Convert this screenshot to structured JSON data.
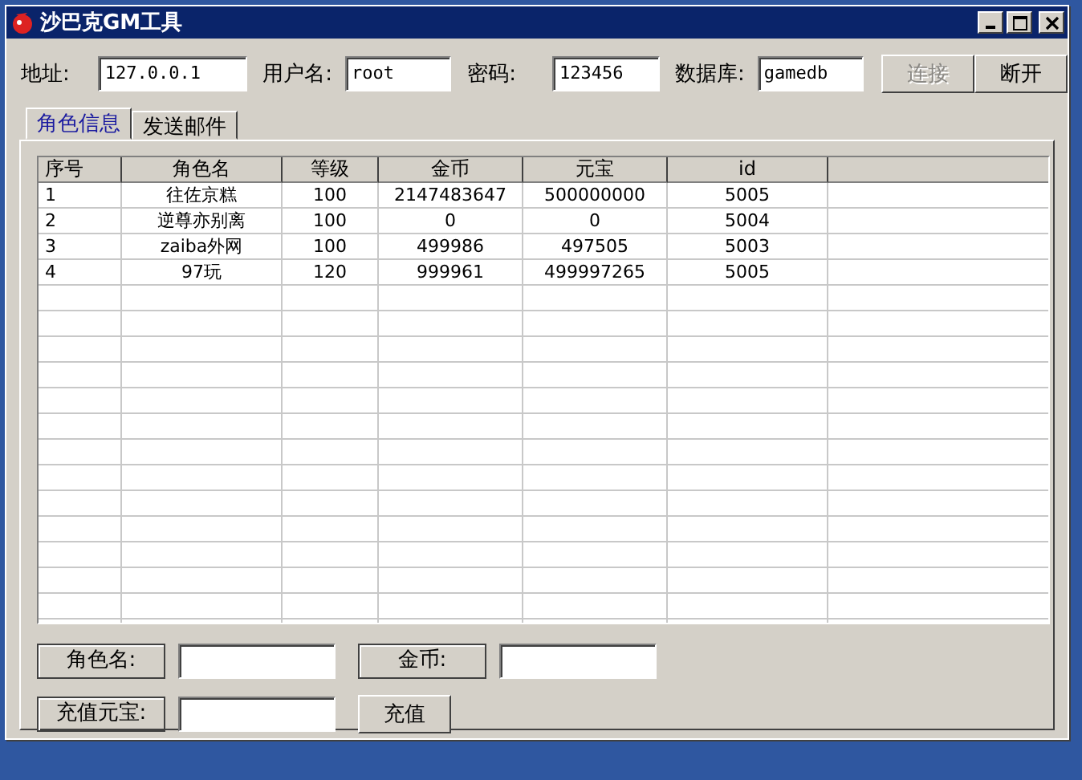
{
  "window": {
    "title": "沙巴克GM工具"
  },
  "connection": {
    "fields": [
      {
        "label": "地址:",
        "value": "127.0.0.1"
      },
      {
        "label": "用户名:",
        "value": "root"
      },
      {
        "label": "密码:",
        "value": "123456"
      },
      {
        "label": "数据库:",
        "value": "gamedb"
      }
    ],
    "buttons": [
      {
        "label": "连接",
        "disabled": true
      },
      {
        "label": "断开",
        "disabled": false
      }
    ]
  },
  "tabs": [
    {
      "label": "角色信息",
      "selected": true
    },
    {
      "label": "发送邮件",
      "selected": false
    }
  ],
  "table": {
    "columns": [
      "序号",
      "角色名",
      "等级",
      "金币",
      "元宝",
      "id"
    ],
    "rows": [
      [
        "1",
        "往佐京糕",
        "100",
        "2147483647",
        "500000000",
        "5005"
      ],
      [
        "2",
        "逆尊亦别离",
        "100",
        "0",
        "0",
        "5004"
      ],
      [
        "3",
        "zaiba外网",
        "100",
        "499986",
        "497505",
        "5003"
      ],
      [
        "4",
        "97玩",
        "120",
        "999961",
        "499997265",
        "5005"
      ]
    ]
  },
  "form": {
    "rows": [
      [
        {
          "kind": "label",
          "text": "角色名:"
        },
        {
          "kind": "input"
        },
        {
          "kind": "label",
          "text": "金币:"
        },
        {
          "kind": "input"
        }
      ],
      [
        {
          "kind": "label",
          "text": "充值元宝:"
        },
        {
          "kind": "input"
        },
        {
          "kind": "button",
          "text": "充值"
        }
      ]
    ]
  }
}
